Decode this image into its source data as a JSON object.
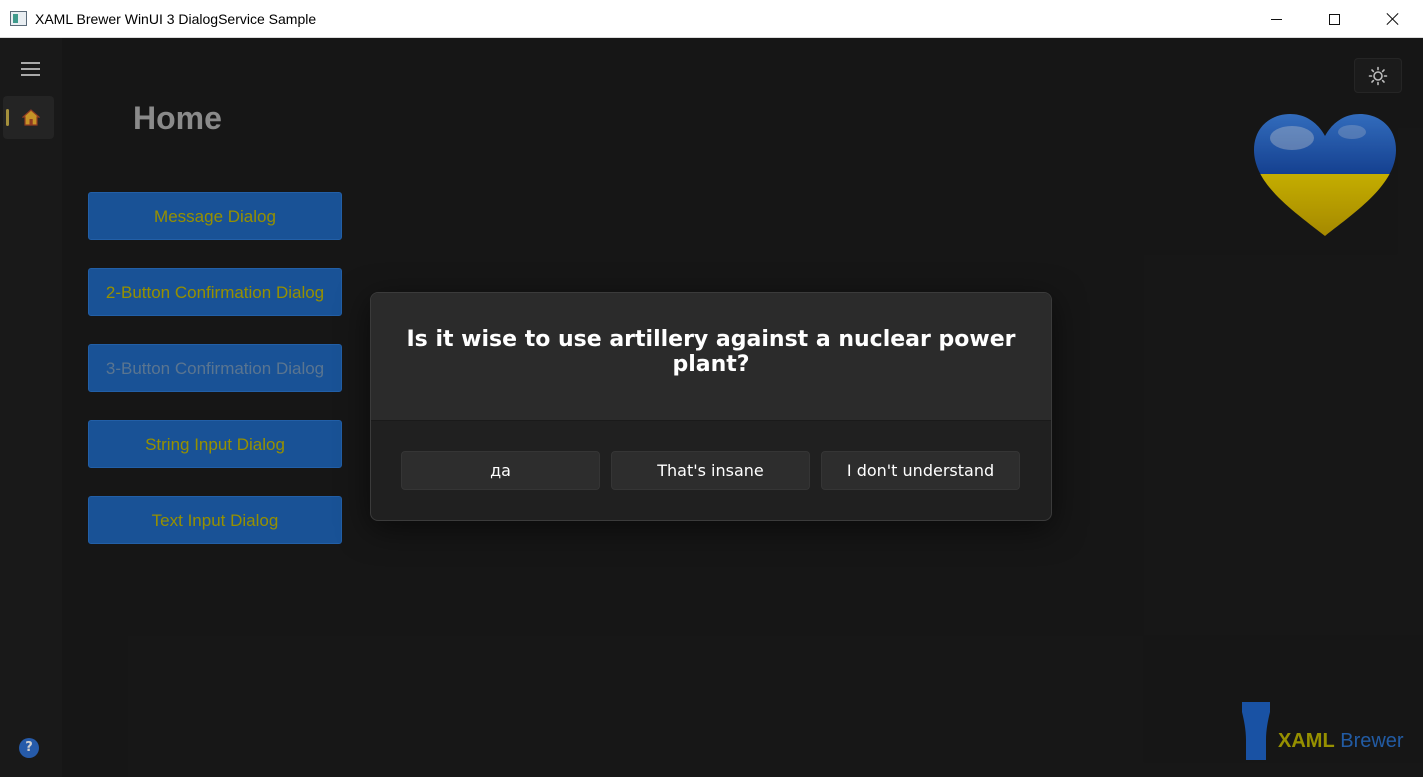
{
  "window": {
    "title": "XAML Brewer WinUI 3 DialogService Sample"
  },
  "nav": {
    "help_glyph": "?"
  },
  "page": {
    "title": "Home",
    "buttons": [
      "Message Dialog",
      "2-Button Confirmation Dialog",
      "3-Button Confirmation Dialog",
      "String Input Dialog",
      "Text Input Dialog"
    ]
  },
  "dialog": {
    "title": "Is it wise to use artillery against a nuclear power plant?",
    "buttons": [
      "да",
      "That's insane",
      "I don't understand"
    ]
  },
  "brand": {
    "part1": "XAML",
    "part2": "Brewer"
  },
  "colors": {
    "accent_blue": "#1f64b8",
    "button_text_yellow": "#b8b000",
    "ukraine_blue": "#1e5fc8",
    "ukraine_yellow": "#e0c300"
  },
  "icons": {
    "app": "app-icon",
    "minimize": "minimize-icon",
    "maximize": "maximize-icon",
    "close": "close-icon",
    "menu": "hamburger-menu-icon",
    "home": "home-icon",
    "theme": "sun-icon",
    "help": "help-icon"
  }
}
